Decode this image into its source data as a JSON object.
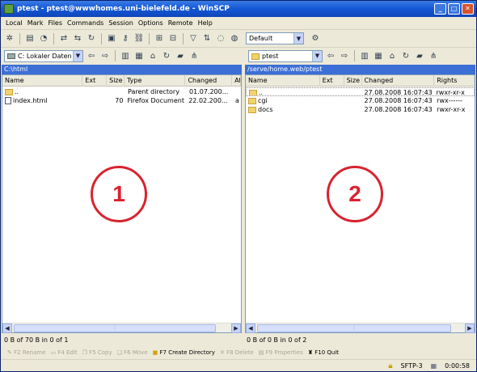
{
  "window": {
    "title": "ptest - ptest@wwwhomes.uni-bielefeld.de - WinSCP",
    "controls": [
      "_",
      "□",
      "✕"
    ]
  },
  "menu": [
    "Local",
    "Mark",
    "Files",
    "Commands",
    "Session",
    "Options",
    "Remote",
    "Help"
  ],
  "toolbar": {
    "profile": "Default"
  },
  "left": {
    "drive": "C: Lokaler Daten",
    "path": "C:\\html",
    "headers": [
      "Name",
      "Ext",
      "Size",
      "Type",
      "Changed",
      "At"
    ],
    "rows": [
      {
        "name": "..",
        "size": "",
        "type": "Parent directory",
        "changed": "01.07.200...",
        "attr": "",
        "icon": "folder-up"
      },
      {
        "name": "index.html",
        "size": "70",
        "type": "Firefox Document",
        "changed": "22.02.200...",
        "attr": "a",
        "icon": "document"
      }
    ],
    "status": "0 B of 70 B in 0 of 1",
    "badge": "1"
  },
  "right": {
    "dir": "ptest",
    "path": "/serve/home.web/ptest",
    "headers": [
      "Name",
      "Ext",
      "Size",
      "Changed",
      "Rights"
    ],
    "rows": [
      {
        "name": "..",
        "changed": "27.08.2008 16:07:43",
        "rights": "rwxr-xr-x",
        "icon": "folder-up"
      },
      {
        "name": "cgi",
        "changed": "27.08.2008 16:07:43",
        "rights": "rwx------",
        "icon": "folder"
      },
      {
        "name": "docs",
        "changed": "27.08.2008 16:07:43",
        "rights": "rwxr-xr-x",
        "icon": "folder"
      }
    ],
    "status": "0 B of 0 B in 0 of 2",
    "badge": "2"
  },
  "fkeys": [
    "F2 Rename",
    "F4 Edit",
    "F5 Copy",
    "F6 Move",
    "F7 Create Directory",
    "F8 Delete",
    "F9 Properties",
    "F10 Quit"
  ],
  "bottom": {
    "protocol": "SFTP-3",
    "time": "0:00:58"
  }
}
